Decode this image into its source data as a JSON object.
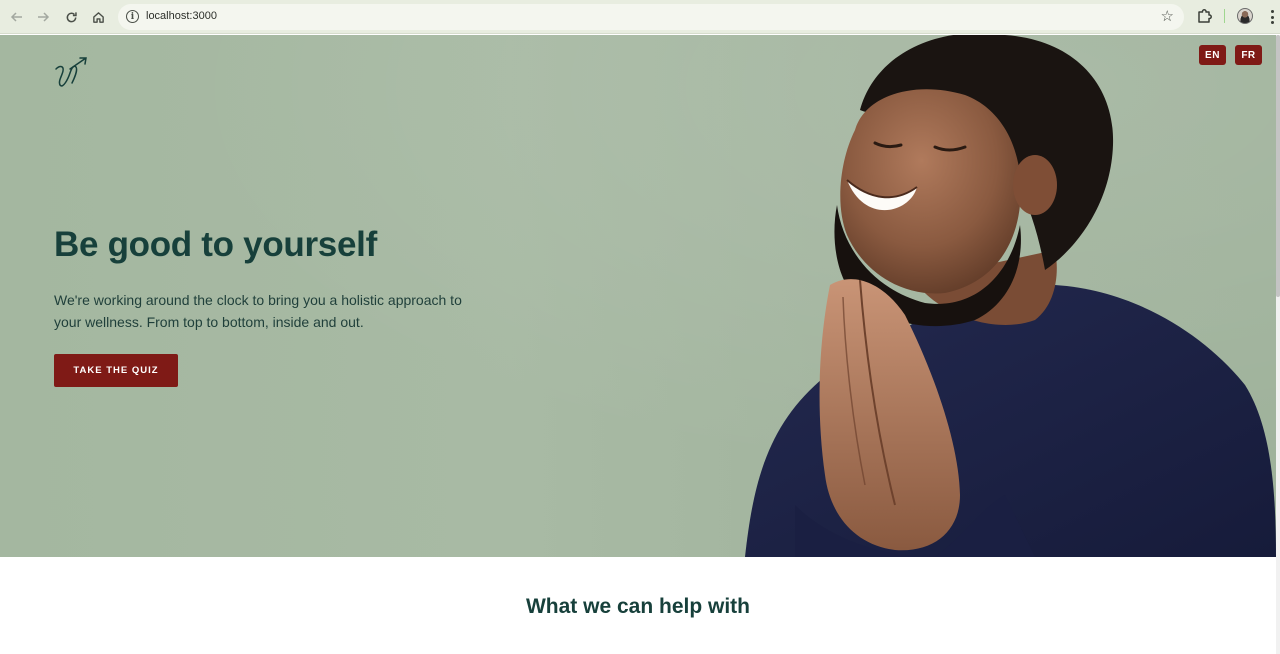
{
  "browser": {
    "url": "localhost:3000",
    "icons": {
      "back": "arrow-left-icon",
      "forward": "arrow-right-icon",
      "reload": "reload-icon",
      "home": "home-icon",
      "info": "info-icon",
      "bookmark": "star-icon",
      "extensions": "puzzle-icon",
      "profile": "avatar",
      "menu": "kebab-menu-icon"
    }
  },
  "header": {
    "languages": [
      "EN",
      "FR"
    ]
  },
  "hero": {
    "title": "Be good to yourself",
    "text": "We're working around the clock to bring you a holistic approach to your wellness. From top to bottom, inside and out.",
    "cta_label": "TAKE THE QUIZ"
  },
  "section": {
    "title": "What we can help with"
  },
  "colors": {
    "accent": "#7f1a16",
    "heading": "#17403b",
    "hero_background": "#a4b7a0",
    "sweater": "#1e2447"
  }
}
